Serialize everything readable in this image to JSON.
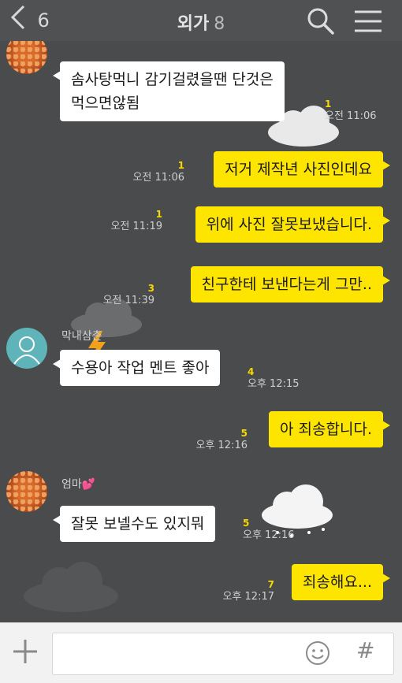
{
  "header": {
    "back_count": "6",
    "title": "외가",
    "member_count": "8"
  },
  "messages": [
    {
      "id": "m1",
      "direction": "in",
      "text": "솜사탕먹니 감기걸렸을땐 단것은\n먹으면않됨",
      "time": "오전 11:06",
      "unread": "1"
    },
    {
      "id": "m2",
      "direction": "out",
      "text": "저거 제작년 사진인데요",
      "time": "오전 11:06",
      "unread": "1"
    },
    {
      "id": "m3",
      "direction": "out",
      "text": "위에 사진 잘못보냈습니다.",
      "time": "오전 11:19",
      "unread": "1"
    },
    {
      "id": "m4",
      "direction": "out",
      "text": "친구한테 보낸다는게 그만..",
      "time": "오전 11:39",
      "unread": "3"
    },
    {
      "id": "m5",
      "direction": "in",
      "sender": "막내삼촌",
      "text": "수용아 작업 멘트 좋아",
      "time": "오후 12:15",
      "unread": "4"
    },
    {
      "id": "m6",
      "direction": "out",
      "text": "아 죄송합니다.",
      "time": "오후 12:16",
      "unread": "5"
    },
    {
      "id": "m7",
      "direction": "in",
      "sender": "엄마",
      "sender_emoji": "💕",
      "text": "잘못 보넬수도 있지뭐",
      "time": "오후 12:16",
      "unread": "5"
    },
    {
      "id": "m8",
      "direction": "out",
      "text": "죄송해요...",
      "time": "오후 12:17",
      "unread": "7"
    }
  ],
  "input": {
    "placeholder": "",
    "hash_label": "#"
  },
  "icons": {
    "back": "chevron-left-icon",
    "search": "search-icon",
    "menu": "menu-icon",
    "plus": "plus-icon",
    "emoji": "smiley-icon",
    "hash": "hash-icon"
  },
  "colors": {
    "chat_background": "#4a4b4d",
    "outgoing_bubble": "#fee500",
    "incoming_bubble": "#ffffff",
    "unread_count": "#f7d900"
  }
}
